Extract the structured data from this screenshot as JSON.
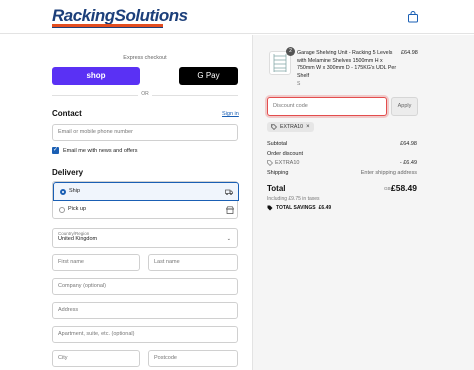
{
  "header": {
    "logo_text": "RackingSolutions",
    "cart_icon": "shopping-bag-icon"
  },
  "express": {
    "label": "Express checkout",
    "shop_label": "shop",
    "gpay_label": "G Pay"
  },
  "divider_label": "OR",
  "contact": {
    "title": "Contact",
    "sign_in": "Sign in",
    "email_placeholder": "Email or mobile phone number",
    "news_label": "Email me with news and offers"
  },
  "delivery": {
    "title": "Delivery",
    "options": [
      {
        "label": "Ship",
        "selected": true,
        "icon": "truck-icon"
      },
      {
        "label": "Pick up",
        "selected": false,
        "icon": "store-icon"
      }
    ],
    "country_label": "Country/Region",
    "country_value": "United Kingdom",
    "first_name": "First name",
    "last_name": "Last name",
    "company": "Company (optional)",
    "address": "Address",
    "apartment": "Apartment, suite, etc. (optional)",
    "city": "City",
    "postcode": "Postcode"
  },
  "summary": {
    "product": {
      "qty": "2",
      "name": "Garage Shelving Unit - Racking 5 Levels with Melamine Shelves 1500mm H x 750mm W x 300mm D - 175KG's UDL Per Shelf",
      "variant": "S",
      "price": "£64.98"
    },
    "discount_placeholder": "Discount code",
    "apply_label": "Apply",
    "applied_code": "EXTRA10",
    "subtotal_label": "Subtotal",
    "subtotal_value": "£64.98",
    "order_discount_label": "Order discount",
    "order_discount_code": "EXTRA10",
    "order_discount_value": "- £6.49",
    "shipping_label": "Shipping",
    "shipping_value": "Enter shipping address",
    "total_label": "Total",
    "total_currency": "GBP",
    "total_value": "£58.49",
    "tax_note": "Including £9.75 in taxes",
    "savings_label": "TOTAL SAVINGS",
    "savings_value": "£6.49"
  },
  "colors": {
    "brand_blue": "#1c3f7a",
    "brand_orange": "#e34d20",
    "shop_purple": "#5a31f4",
    "link_blue": "#1a5fb4",
    "error_red": "#e34d4d"
  }
}
